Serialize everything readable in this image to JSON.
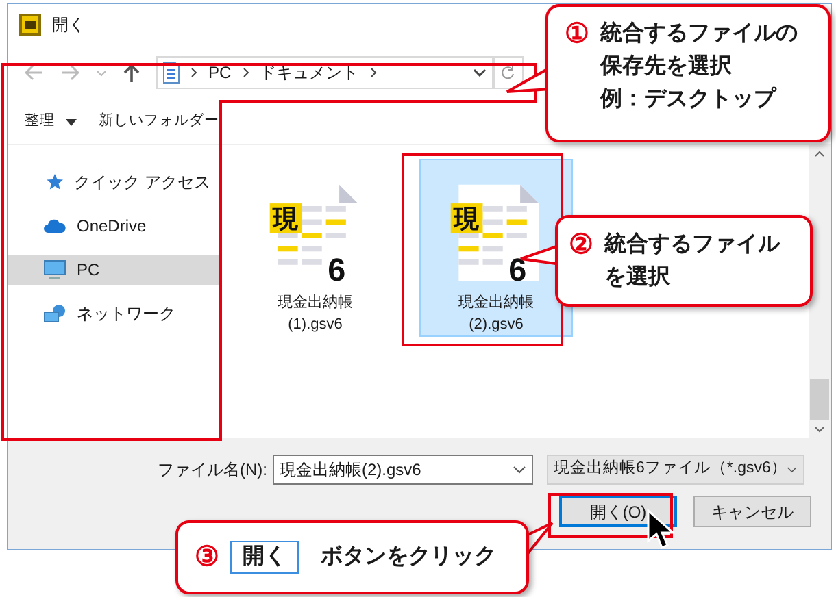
{
  "window": {
    "title": "開く"
  },
  "address_bar": {
    "path": [
      "PC",
      "ドキュメント"
    ]
  },
  "toolbar": {
    "items": [
      {
        "label": "整理",
        "kind": "menu"
      },
      {
        "label": "新しいフォルダー",
        "kind": "button"
      }
    ]
  },
  "sidebar": {
    "items": [
      {
        "label": "クイック アクセス",
        "kind": "quick-access",
        "selected": false
      },
      {
        "label": "OneDrive",
        "kind": "cloud",
        "selected": false
      },
      {
        "label": "PC",
        "kind": "computer",
        "selected": true
      },
      {
        "label": "ネットワーク",
        "kind": "network",
        "selected": false
      }
    ]
  },
  "files": [
    {
      "name": "現金出納帳(1).gsv6",
      "icon_badge": "現",
      "icon_number": "6",
      "selected": false
    },
    {
      "name": "現金出納帳(2).gsv6",
      "icon_badge": "現",
      "icon_number": "6",
      "selected": true
    }
  ],
  "file_name": {
    "label": "ファイル名(N):",
    "value": "現金出納帳(2).gsv6"
  },
  "file_type": {
    "value": "現金出納帳6ファイル（*.gsv6）"
  },
  "buttons": [
    {
      "label": "開く(O)",
      "default": true
    },
    {
      "label": "キャンセル",
      "default": false
    }
  ],
  "callouts": [
    {
      "number": "①",
      "lines": [
        "統合するファイルの",
        "保存先を選択",
        "例：デスクトップ"
      ]
    },
    {
      "number": "②",
      "lines": [
        "統合するファイル",
        "を選択"
      ]
    },
    {
      "number": "③",
      "button_label": "開く",
      "text": "ボタンをクリック"
    }
  ]
}
